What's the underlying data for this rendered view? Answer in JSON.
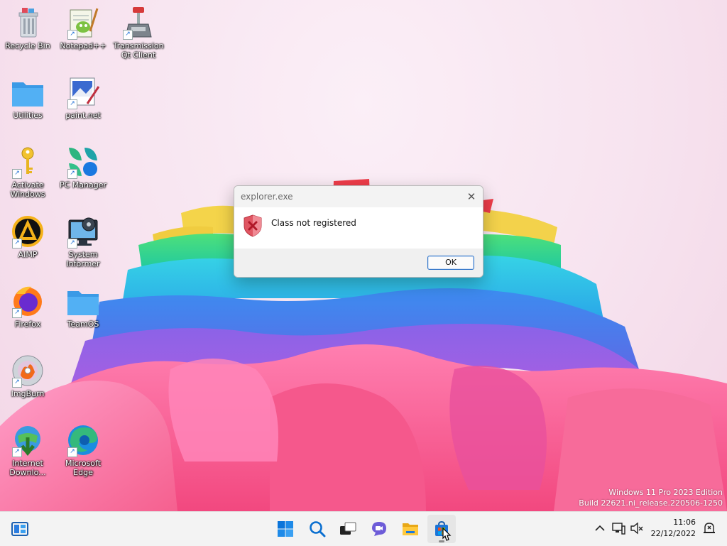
{
  "desktop": {
    "icons": [
      {
        "label": "Recycle Bin"
      },
      {
        "label": "Notepad++"
      },
      {
        "label": "Transmission Qt Client"
      },
      {
        "label": "Utilities"
      },
      {
        "label": "paint.net"
      },
      {
        "label": "Activate Windows"
      },
      {
        "label": "PC Manager"
      },
      {
        "label": "AIMP"
      },
      {
        "label": "System Informer"
      },
      {
        "label": "Firefox"
      },
      {
        "label": "TeamOS"
      },
      {
        "label": "ImgBurn"
      },
      {
        "label": "Internet Downlo..."
      },
      {
        "label": "Microsoft Edge"
      }
    ]
  },
  "dialog": {
    "title": "explorer.exe",
    "close_glyph": "✕",
    "message": "Class not registered",
    "ok_label": "OK"
  },
  "watermark": {
    "line1": "Windows 11 Pro 2023 Edition",
    "line2": "Build 22621.ni_release.220506-1250"
  },
  "taskbar": {
    "widgets_icon": "widgets-icon",
    "pinned": [
      {
        "icon": "start-icon"
      },
      {
        "icon": "search-icon"
      },
      {
        "icon": "task-view-icon"
      },
      {
        "icon": "chat-icon"
      },
      {
        "icon": "file-explorer-icon"
      },
      {
        "icon": "store-icon"
      }
    ],
    "clock": {
      "time": "11:06",
      "date": "22/12/2022"
    },
    "colors": {
      "accent": "#0067c0",
      "background": "#f3f3f3"
    }
  }
}
